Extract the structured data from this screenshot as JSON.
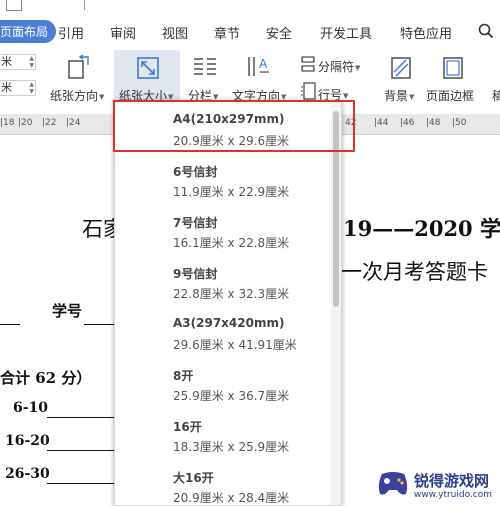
{
  "tabs": [
    {
      "label": "页面布局"
    },
    {
      "label": "引用"
    },
    {
      "label": "审阅"
    },
    {
      "label": "视图"
    },
    {
      "label": "章节"
    },
    {
      "label": "安全"
    },
    {
      "label": "开发工具"
    },
    {
      "label": "特色应用"
    }
  ],
  "ribbon": {
    "spin1_suffix": "米",
    "spin2_suffix": "米",
    "orientation": "纸张方向",
    "size": "纸张大小",
    "columns": "分栏",
    "text_direction": "文字方向",
    "separator": "分隔符",
    "line_numbers": "行号",
    "background": "背景",
    "page_border": "页面边框",
    "more": "稿"
  },
  "ruler_ticks": [
    "|18",
    "|20",
    "|22",
    "|24",
    "42",
    "|44",
    "|46",
    "|48",
    "|50"
  ],
  "document": {
    "line1_left": "石家",
    "line1_right": "19——2020 学",
    "line2_right": "一次月考答题卡",
    "student_no": "学号",
    "total": "合计 62 分）",
    "q1": "6-10",
    "q2": "16-20",
    "q3": "26-30"
  },
  "paper_sizes": [
    {
      "name": "A4(210x297mm)",
      "size": "20.9厘米 x 29.6厘米"
    },
    {
      "name": "6号信封",
      "size": "11.9厘米 x 22.9厘米"
    },
    {
      "name": "7号信封",
      "size": "16.1厘米 x 22.8厘米"
    },
    {
      "name": "9号信封",
      "size": "22.8厘米 x 32.3厘米"
    },
    {
      "name": "A3(297x420mm)",
      "size": "29.6厘米 x 41.91厘米"
    },
    {
      "name": "8开",
      "size": "25.9厘米 x 36.7厘米"
    },
    {
      "name": "16开",
      "size": "18.3厘米 x 25.9厘米"
    },
    {
      "name": "大16开",
      "size": "20.9厘米 x 28.4厘米"
    }
  ],
  "watermark": {
    "name": "锐得游戏网",
    "url": "www.ytruido.com"
  },
  "colors": {
    "accent": "#4b7fd6",
    "highlight": "#e0312d"
  }
}
